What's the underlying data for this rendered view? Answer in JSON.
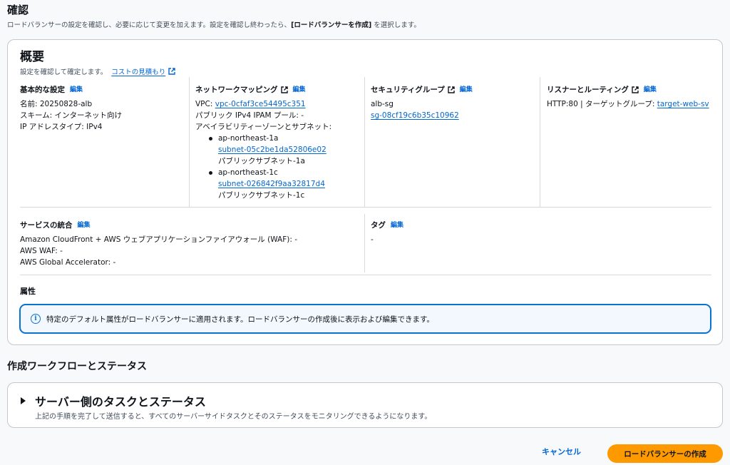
{
  "page": {
    "title": "確認",
    "description_pre": "ロードバランサーの設定を確認し、必要に応じて変更を加えます。設定を確認し終わったら、",
    "description_bold": "[ロードバランサーを作成]",
    "description_post": " を選択します。"
  },
  "summary": {
    "title": "概要",
    "subtitle": "設定を確認して確定します。",
    "cost_link": "コストの見積もり",
    "edit_label": "編集",
    "basic": {
      "heading": "基本的な設定",
      "name": "名前: 20250828-alb",
      "scheme": "スキーム: インターネット向け",
      "ip_type": "IP アドレスタイプ: IPv4"
    },
    "network": {
      "heading": "ネットワークマッピング",
      "vpc_label": "VPC: ",
      "vpc_id": "vpc-0cfaf3ce54495c351",
      "ipam": "パブリック IPv4 IPAM プール: -",
      "az_label": "アベイラビリティーゾーンとサブネット:",
      "subnets": [
        {
          "az": "ap-northeast-1a",
          "subnet": "subnet-05c2be1da52806e02",
          "name": "パブリックサブネット-1a"
        },
        {
          "az": "ap-northeast-1c",
          "subnet": "subnet-026842f9aa32817d4",
          "name": "パブリックサブネット-1c"
        }
      ]
    },
    "security": {
      "heading": "セキュリティグループ",
      "name": "alb-sg",
      "id": "sg-08cf19c6b35c10962"
    },
    "listener": {
      "heading": "リスナーとルーティング",
      "text": "HTTP:80 | ターゲットグループ: ",
      "target_link": "target-web-sv"
    },
    "integration": {
      "heading": "サービスの統合",
      "line1": "Amazon CloudFront + AWS ウェブアプリケーションファイアウォール (WAF): -",
      "line2": "AWS WAF: -",
      "line3": "AWS Global Accelerator: -"
    },
    "tags": {
      "heading": "タグ",
      "value": "-"
    },
    "attributes": {
      "heading": "属性",
      "info": "特定のデフォルト属性がロードバランサーに適用されます。ロードバランサーの作成後に表示および編集できます。"
    }
  },
  "workflow": {
    "title": "作成ワークフローとステータス",
    "tasks_title": "サーバー側のタスクとステータス",
    "tasks_desc": "上記の手順を完了して送信すると、すべてのサーバーサイドタスクとそのステータスをモニタリングできるようになります。"
  },
  "actions": {
    "cancel": "キャンセル",
    "create": "ロードバランサーの作成"
  },
  "icons": {
    "external": "external-link-icon",
    "info": "info-icon",
    "caret": "caret-right-icon"
  },
  "colors": {
    "link": "#0066d4",
    "primary_button": "#ff9900",
    "info_border": "#0972d3"
  }
}
